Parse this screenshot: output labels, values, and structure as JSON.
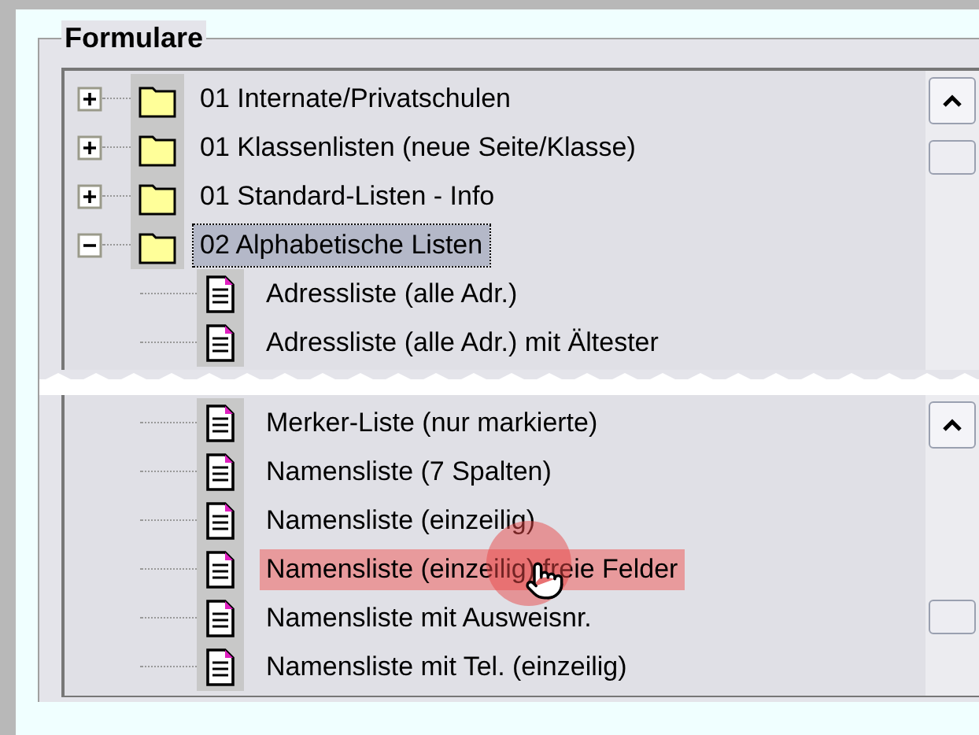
{
  "group": {
    "title": "Formulare"
  },
  "top_tree": {
    "items": [
      {
        "kind": "folder",
        "label": "01 Internate/Privatschulen",
        "expanded": false,
        "selected": false,
        "highlighted": false
      },
      {
        "kind": "folder",
        "label": "01 Klassenlisten (neue Seite/Klasse)",
        "expanded": false,
        "selected": false,
        "highlighted": false
      },
      {
        "kind": "folder",
        "label": "01 Standard-Listen - Info",
        "expanded": false,
        "selected": false,
        "highlighted": false
      },
      {
        "kind": "folder",
        "label": "02 Alphabetische Listen",
        "expanded": true,
        "selected": true,
        "highlighted": false,
        "children": [
          {
            "kind": "document",
            "label": "Adressliste (alle Adr.)",
            "selected": false,
            "highlighted": false
          },
          {
            "kind": "document",
            "label": "Adressliste (alle Adr.) mit Ältester",
            "selected": false,
            "highlighted": false
          }
        ]
      }
    ]
  },
  "bottom_tree": {
    "items": [
      {
        "kind": "document",
        "label": "Merker-Liste (nur markierte)",
        "selected": false,
        "highlighted": false
      },
      {
        "kind": "document",
        "label": "Namensliste (7 Spalten)",
        "selected": false,
        "highlighted": false
      },
      {
        "kind": "document",
        "label": "Namensliste (einzeilig)",
        "selected": false,
        "highlighted": false
      },
      {
        "kind": "document",
        "label": "Namensliste (einzeilig) freie Felder",
        "selected": false,
        "highlighted": true
      },
      {
        "kind": "document",
        "label": "Namensliste mit Ausweisnr.",
        "selected": false,
        "highlighted": false
      },
      {
        "kind": "document",
        "label": "Namensliste mit Tel. (einzeilig)",
        "selected": false,
        "highlighted": false
      }
    ]
  }
}
